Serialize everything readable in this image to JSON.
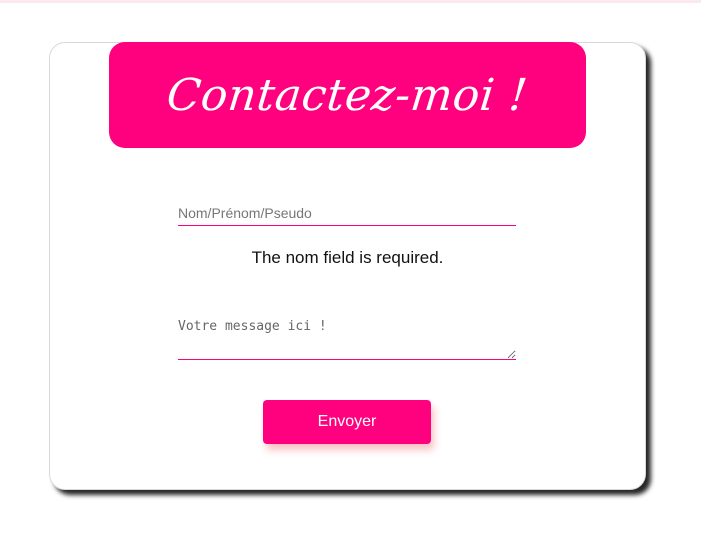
{
  "header": {
    "title": "Contactez-moi !"
  },
  "form": {
    "name_placeholder": "Nom/Prénom/Pseudo",
    "name_value": "",
    "error_message": "The nom field is required.",
    "message_placeholder": "Votre message ici !",
    "message_value": "",
    "submit_label": "Envoyer"
  },
  "colors": {
    "accent": "#ff007f",
    "card_background": "#ffffff",
    "button_text": "#ffffff"
  }
}
